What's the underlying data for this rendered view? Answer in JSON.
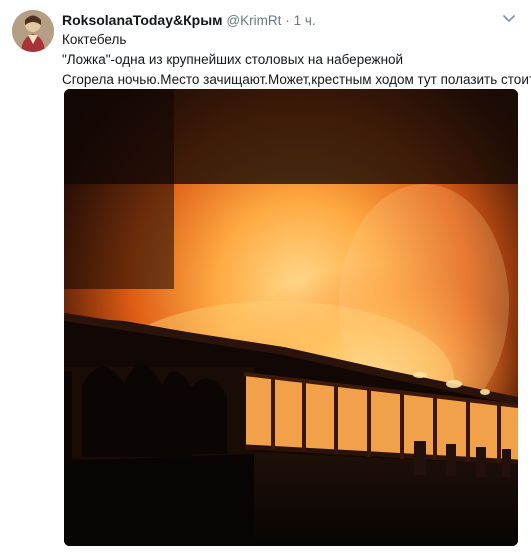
{
  "tweet": {
    "display_name": "RoksolanaToday&Крым",
    "username": "@KrimRt",
    "separator": "·",
    "timestamp": "1 ч.",
    "lines": [
      "Коктебель",
      "\"Ложка\"-одна из крупнейших столовых на набережной",
      "Сгорела ночью.Место зачищают.Может,крестным ходом тут полазить стоит?"
    ]
  },
  "icons": {
    "menu": "chevron-down-icon",
    "avatar": "avatar-image",
    "photo": "fire-photo"
  },
  "colors": {
    "name": "#14171a",
    "meta": "#657786",
    "fire": "#ff8a1e"
  }
}
